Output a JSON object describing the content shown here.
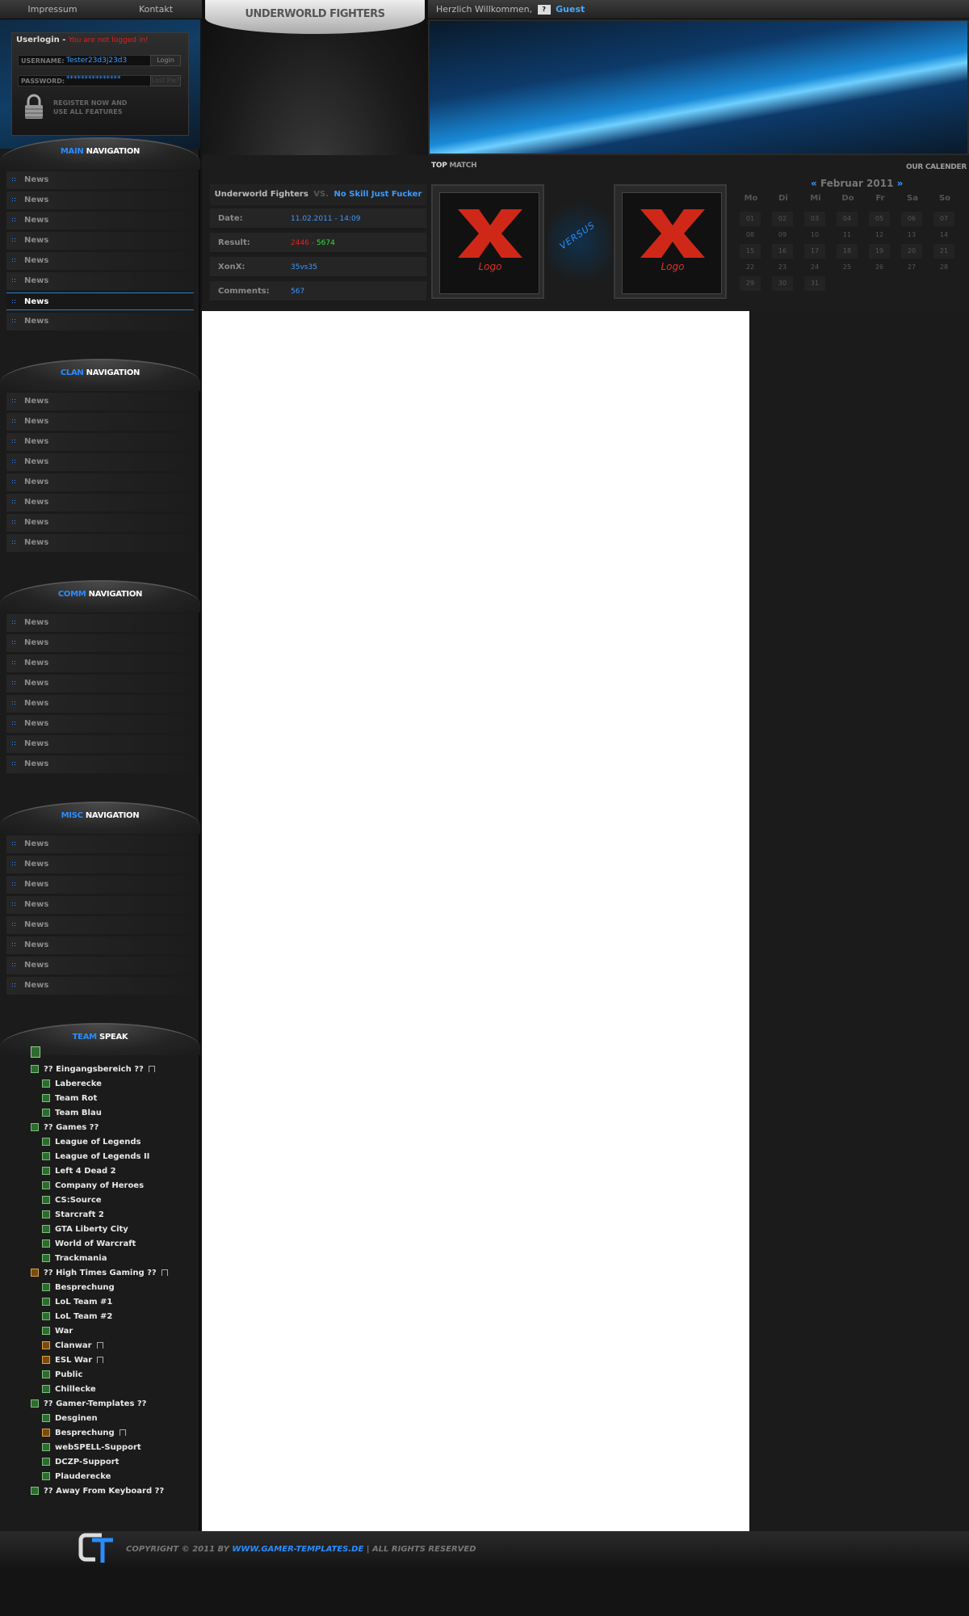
{
  "topbar": {
    "links": [
      "Impressum",
      "Kontakt"
    ],
    "welcome_text": "Herzlich Willkommen,",
    "guest_label": "Guest"
  },
  "header": {
    "site_title": "UNDERWORLD FIGHTERS"
  },
  "login": {
    "title": "Userlogin",
    "status": "You are not logged in!",
    "username_label": "USERNAME:",
    "username_value": "Tester23d3j23d3",
    "password_label": "PASSWORD:",
    "password_value": "***************",
    "login_button": "Login",
    "lost_pw_button": "Lost Pw?",
    "register_line1": "REGISTER NOW AND",
    "register_line2": "USE ALL FEATURES"
  },
  "main_nav": {
    "accent": "MAIN",
    "title": "NAVIGATION",
    "items": [
      "News",
      "News",
      "News",
      "News",
      "News",
      "News",
      "News",
      "News"
    ],
    "active_index": 6
  },
  "clan_nav": {
    "accent": "CLAN",
    "title": "NAVIGATION",
    "items": [
      "News",
      "News",
      "News",
      "News",
      "News",
      "News",
      "News",
      "News"
    ]
  },
  "comm_nav": {
    "accent": "COMM",
    "title": "NAVIGATION",
    "items": [
      "News",
      "News",
      "News",
      "News",
      "News",
      "News",
      "News",
      "News"
    ]
  },
  "misc_nav": {
    "accent": "MISC",
    "title": "NAVIGATION",
    "items": [
      "News",
      "News",
      "News",
      "News",
      "News",
      "News",
      "News",
      "News"
    ]
  },
  "teamspeak": {
    "accent": "TEAM",
    "title": "SPEAK",
    "channels": [
      {
        "label": "?? Eingangsbereich ??",
        "level": 0,
        "locked": true,
        "orange": false
      },
      {
        "label": "Laberecke",
        "level": 1,
        "locked": false,
        "orange": false
      },
      {
        "label": "Team Rot",
        "level": 1,
        "locked": false,
        "orange": false
      },
      {
        "label": "Team Blau",
        "level": 1,
        "locked": false,
        "orange": false
      },
      {
        "label": "?? Games ??",
        "level": 0,
        "locked": false,
        "orange": false
      },
      {
        "label": "League of Legends",
        "level": 1,
        "locked": false,
        "orange": false
      },
      {
        "label": "League of Legends II",
        "level": 1,
        "locked": false,
        "orange": false
      },
      {
        "label": "Left 4 Dead 2",
        "level": 1,
        "locked": false,
        "orange": false
      },
      {
        "label": "Company of Heroes",
        "level": 1,
        "locked": false,
        "orange": false
      },
      {
        "label": "CS:Source",
        "level": 1,
        "locked": false,
        "orange": false
      },
      {
        "label": "Starcraft 2",
        "level": 1,
        "locked": false,
        "orange": false
      },
      {
        "label": "GTA Liberty City",
        "level": 1,
        "locked": false,
        "orange": false
      },
      {
        "label": "World of Warcraft",
        "level": 1,
        "locked": false,
        "orange": false
      },
      {
        "label": "Trackmania",
        "level": 1,
        "locked": false,
        "orange": false
      },
      {
        "label": "?? High Times Gaming ??",
        "level": 0,
        "locked": true,
        "orange": true
      },
      {
        "label": "Besprechung",
        "level": 1,
        "locked": false,
        "orange": false
      },
      {
        "label": "LoL Team #1",
        "level": 1,
        "locked": false,
        "orange": false
      },
      {
        "label": "LoL Team #2",
        "level": 1,
        "locked": false,
        "orange": false
      },
      {
        "label": "War",
        "level": 1,
        "locked": false,
        "orange": false
      },
      {
        "label": "Clanwar",
        "level": 1,
        "locked": true,
        "orange": true
      },
      {
        "label": "ESL War",
        "level": 1,
        "locked": true,
        "orange": true
      },
      {
        "label": "Public",
        "level": 1,
        "locked": false,
        "orange": false
      },
      {
        "label": "Chillecke",
        "level": 1,
        "locked": false,
        "orange": false
      },
      {
        "label": "?? Gamer-Templates ??",
        "level": 0,
        "locked": false,
        "orange": false
      },
      {
        "label": "Desginen",
        "level": 1,
        "locked": false,
        "orange": false
      },
      {
        "label": "Besprechung",
        "level": 1,
        "locked": true,
        "orange": true
      },
      {
        "label": "webSPELL-Support",
        "level": 1,
        "locked": false,
        "orange": false
      },
      {
        "label": "DCZP-Support",
        "level": 1,
        "locked": false,
        "orange": false
      },
      {
        "label": "Plauderecke",
        "level": 1,
        "locked": false,
        "orange": false
      },
      {
        "label": "?? Away From Keyboard ??",
        "level": 0,
        "locked": false,
        "orange": false
      }
    ]
  },
  "top_match": {
    "title_a": "TOP",
    "title_b": "MATCH",
    "team_home": "Underworld Fighters",
    "vs": "VS.",
    "team_opponent": "No Skill Just Fucker",
    "rows": [
      {
        "label": "Date:",
        "value": "11.02.2011 - 14:09"
      },
      {
        "label": "Result:",
        "value_home": "2446",
        "sep": " - ",
        "value_opp": "5674"
      },
      {
        "label": "XonX:",
        "value": "35vs35"
      },
      {
        "label": "Comments:",
        "value": "567"
      }
    ],
    "logo_text": "Logo",
    "versus_text": "VERSUS",
    "colors": {
      "home_score": "#e82020",
      "opp_score": "#36e036"
    }
  },
  "calendar": {
    "title": "OUR CALENDER",
    "prev": "«",
    "next": "»",
    "month": "Februar 2011",
    "weekdays": [
      "Mo",
      "Di",
      "Mi",
      "Do",
      "Fr",
      "Sa",
      "So"
    ],
    "days": [
      "01",
      "02",
      "03",
      "04",
      "05",
      "06",
      "07",
      "08",
      "09",
      "10",
      "11",
      "12",
      "13",
      "14",
      "15",
      "16",
      "17",
      "18",
      "19",
      "20",
      "21",
      "22",
      "23",
      "24",
      "25",
      "26",
      "27",
      "28",
      "29",
      "30",
      "31"
    ]
  },
  "footer": {
    "copyright": "COPYRIGHT © 2011 BY",
    "url": "WWW.GAMER-TEMPLATES.DE",
    "rights": "| ALL RIGHTS RESERVED"
  },
  "colors": {
    "accent": "#2a8cff",
    "error": "#e02020"
  }
}
